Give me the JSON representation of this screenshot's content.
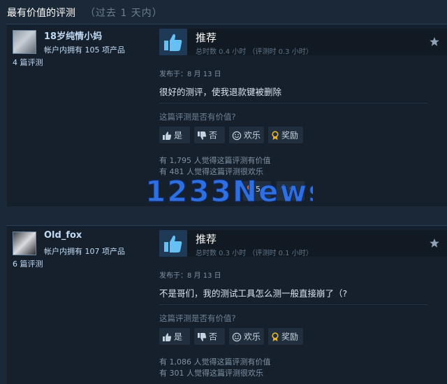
{
  "header": {
    "title": "最有价值的评测",
    "subtitle": "（过去 1 天内）"
  },
  "reviews": [
    {
      "user_name": "18岁纯情小妈",
      "products_owned": "帐户内拥有 105 项产品",
      "review_count": "4 篇评测",
      "recommendation": "推荐",
      "hours": "总时数 0.4 小时 （评测时 0.3 小时）",
      "posted": "发布于：8 月 13 日",
      "content": "很好的测评，使我退款键被删除",
      "helpful_question": "这篇评测是否有价值?",
      "buttons": {
        "yes": "是",
        "no": "否",
        "funny": "欢乐",
        "award": "奖励"
      },
      "helpful_stat": "有 1,795 人觉得这篇评测有价值",
      "funny_stat": "有 481 人觉得这篇评测很欢乐",
      "awards": [
        {
          "count": "5"
        },
        {
          "count": "6"
        }
      ]
    },
    {
      "user_name": "Old_fox",
      "products_owned": "帐户内拥有 107 项产品",
      "review_count": "6 篇评测",
      "recommendation": "推荐",
      "hours": "总时数 0.3 小时 （评测时 0.1 小时）",
      "posted": "发布于：8 月 13 日",
      "content": "不是哥们，我的测试工具怎么测一般直接崩了（?",
      "helpful_question": "这篇评测是否有价值?",
      "buttons": {
        "yes": "是",
        "no": "否",
        "funny": "欢乐",
        "award": "奖励"
      },
      "helpful_stat": "有 1,086 人觉得这篇评测有价值",
      "funny_stat": "有 301 人觉得这篇评测很欢乐"
    }
  ],
  "watermark": {
    "text": "1233News"
  },
  "colors": {
    "background": "#1b2838",
    "card": "#16202d",
    "thumb_box": "#1f3a57",
    "thumb_icon": "#66c0f4",
    "watermark_blue": "#2f6fe0",
    "watermark_accent": "#7ec3ff"
  },
  "icons": {
    "recommend": "thumbs-up-icon",
    "steam": "steam-logo-icon",
    "yes": "thumbs-up-icon",
    "no": "thumbs-down-icon",
    "funny": "smiley-icon",
    "award": "award-ribbon-icon"
  }
}
